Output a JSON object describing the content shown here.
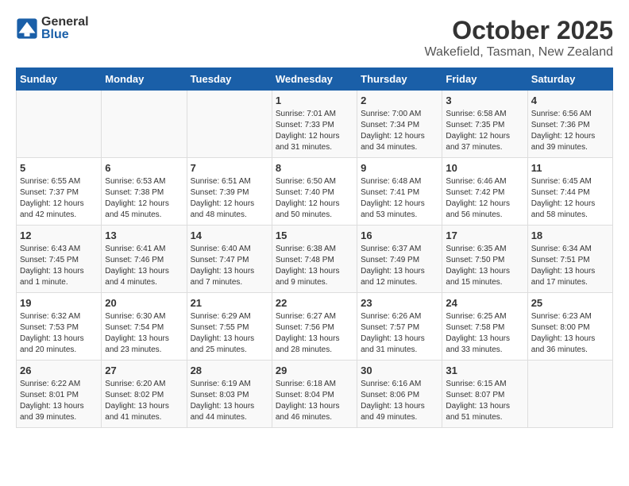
{
  "header": {
    "logo_general": "General",
    "logo_blue": "Blue",
    "title": "October 2025",
    "subtitle": "Wakefield, Tasman, New Zealand"
  },
  "weekdays": [
    "Sunday",
    "Monday",
    "Tuesday",
    "Wednesday",
    "Thursday",
    "Friday",
    "Saturday"
  ],
  "weeks": [
    [
      {
        "day": "",
        "info": ""
      },
      {
        "day": "",
        "info": ""
      },
      {
        "day": "",
        "info": ""
      },
      {
        "day": "1",
        "info": "Sunrise: 7:01 AM\nSunset: 7:33 PM\nDaylight: 12 hours\nand 31 minutes."
      },
      {
        "day": "2",
        "info": "Sunrise: 7:00 AM\nSunset: 7:34 PM\nDaylight: 12 hours\nand 34 minutes."
      },
      {
        "day": "3",
        "info": "Sunrise: 6:58 AM\nSunset: 7:35 PM\nDaylight: 12 hours\nand 37 minutes."
      },
      {
        "day": "4",
        "info": "Sunrise: 6:56 AM\nSunset: 7:36 PM\nDaylight: 12 hours\nand 39 minutes."
      }
    ],
    [
      {
        "day": "5",
        "info": "Sunrise: 6:55 AM\nSunset: 7:37 PM\nDaylight: 12 hours\nand 42 minutes."
      },
      {
        "day": "6",
        "info": "Sunrise: 6:53 AM\nSunset: 7:38 PM\nDaylight: 12 hours\nand 45 minutes."
      },
      {
        "day": "7",
        "info": "Sunrise: 6:51 AM\nSunset: 7:39 PM\nDaylight: 12 hours\nand 48 minutes."
      },
      {
        "day": "8",
        "info": "Sunrise: 6:50 AM\nSunset: 7:40 PM\nDaylight: 12 hours\nand 50 minutes."
      },
      {
        "day": "9",
        "info": "Sunrise: 6:48 AM\nSunset: 7:41 PM\nDaylight: 12 hours\nand 53 minutes."
      },
      {
        "day": "10",
        "info": "Sunrise: 6:46 AM\nSunset: 7:42 PM\nDaylight: 12 hours\nand 56 minutes."
      },
      {
        "day": "11",
        "info": "Sunrise: 6:45 AM\nSunset: 7:44 PM\nDaylight: 12 hours\nand 58 minutes."
      }
    ],
    [
      {
        "day": "12",
        "info": "Sunrise: 6:43 AM\nSunset: 7:45 PM\nDaylight: 13 hours\nand 1 minute."
      },
      {
        "day": "13",
        "info": "Sunrise: 6:41 AM\nSunset: 7:46 PM\nDaylight: 13 hours\nand 4 minutes."
      },
      {
        "day": "14",
        "info": "Sunrise: 6:40 AM\nSunset: 7:47 PM\nDaylight: 13 hours\nand 7 minutes."
      },
      {
        "day": "15",
        "info": "Sunrise: 6:38 AM\nSunset: 7:48 PM\nDaylight: 13 hours\nand 9 minutes."
      },
      {
        "day": "16",
        "info": "Sunrise: 6:37 AM\nSunset: 7:49 PM\nDaylight: 13 hours\nand 12 minutes."
      },
      {
        "day": "17",
        "info": "Sunrise: 6:35 AM\nSunset: 7:50 PM\nDaylight: 13 hours\nand 15 minutes."
      },
      {
        "day": "18",
        "info": "Sunrise: 6:34 AM\nSunset: 7:51 PM\nDaylight: 13 hours\nand 17 minutes."
      }
    ],
    [
      {
        "day": "19",
        "info": "Sunrise: 6:32 AM\nSunset: 7:53 PM\nDaylight: 13 hours\nand 20 minutes."
      },
      {
        "day": "20",
        "info": "Sunrise: 6:30 AM\nSunset: 7:54 PM\nDaylight: 13 hours\nand 23 minutes."
      },
      {
        "day": "21",
        "info": "Sunrise: 6:29 AM\nSunset: 7:55 PM\nDaylight: 13 hours\nand 25 minutes."
      },
      {
        "day": "22",
        "info": "Sunrise: 6:27 AM\nSunset: 7:56 PM\nDaylight: 13 hours\nand 28 minutes."
      },
      {
        "day": "23",
        "info": "Sunrise: 6:26 AM\nSunset: 7:57 PM\nDaylight: 13 hours\nand 31 minutes."
      },
      {
        "day": "24",
        "info": "Sunrise: 6:25 AM\nSunset: 7:58 PM\nDaylight: 13 hours\nand 33 minutes."
      },
      {
        "day": "25",
        "info": "Sunrise: 6:23 AM\nSunset: 8:00 PM\nDaylight: 13 hours\nand 36 minutes."
      }
    ],
    [
      {
        "day": "26",
        "info": "Sunrise: 6:22 AM\nSunset: 8:01 PM\nDaylight: 13 hours\nand 39 minutes."
      },
      {
        "day": "27",
        "info": "Sunrise: 6:20 AM\nSunset: 8:02 PM\nDaylight: 13 hours\nand 41 minutes."
      },
      {
        "day": "28",
        "info": "Sunrise: 6:19 AM\nSunset: 8:03 PM\nDaylight: 13 hours\nand 44 minutes."
      },
      {
        "day": "29",
        "info": "Sunrise: 6:18 AM\nSunset: 8:04 PM\nDaylight: 13 hours\nand 46 minutes."
      },
      {
        "day": "30",
        "info": "Sunrise: 6:16 AM\nSunset: 8:06 PM\nDaylight: 13 hours\nand 49 minutes."
      },
      {
        "day": "31",
        "info": "Sunrise: 6:15 AM\nSunset: 8:07 PM\nDaylight: 13 hours\nand 51 minutes."
      },
      {
        "day": "",
        "info": ""
      }
    ]
  ]
}
